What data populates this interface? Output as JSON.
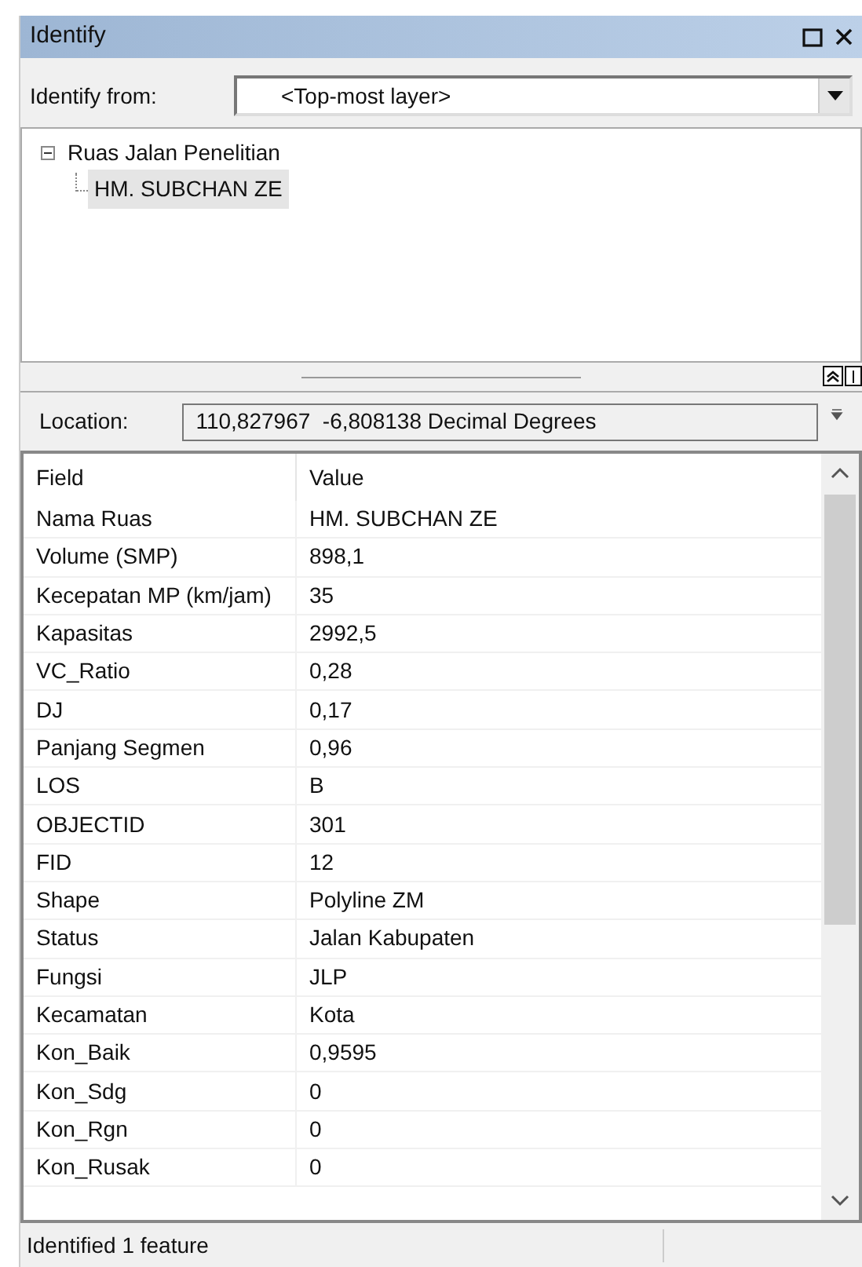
{
  "window": {
    "title": "Identify"
  },
  "identify_from": {
    "label": "Identify from:",
    "value": "<Top-most layer>"
  },
  "tree": [
    {
      "label": "Ruas Jalan Penelitian",
      "expanded": true,
      "selected": false,
      "children": [
        {
          "label": "HM. SUBCHAN ZE",
          "selected": true
        }
      ]
    }
  ],
  "location": {
    "label": "Location:",
    "value": "110,827967  -6,808138 Decimal Degrees"
  },
  "table": {
    "columns": [
      "Field",
      "Value"
    ],
    "rows": [
      [
        "Nama Ruas",
        "HM. SUBCHAN ZE"
      ],
      [
        "Volume (SMP)",
        "898,1"
      ],
      [
        "Kecepatan MP (km/jam)",
        "35"
      ],
      [
        "Kapasitas",
        "2992,5"
      ],
      [
        "VC_Ratio",
        "0,28"
      ],
      [
        "DJ",
        "0,17"
      ],
      [
        "Panjang Segmen",
        "0,96"
      ],
      [
        "LOS",
        "B"
      ],
      [
        "OBJECTID",
        "301"
      ],
      [
        "FID",
        "12"
      ],
      [
        "Shape",
        "Polyline ZM"
      ],
      [
        "Status",
        "Jalan Kabupaten"
      ],
      [
        "Fungsi",
        "JLP"
      ],
      [
        "Kecamatan",
        "Kota"
      ],
      [
        "Kon_Baik",
        "0,9595"
      ],
      [
        "Kon_Sdg",
        "0"
      ],
      [
        "Kon_Rgn",
        "0"
      ],
      [
        "Kon_Rusak",
        "0"
      ]
    ]
  },
  "status_bar": "Identified 1 feature"
}
